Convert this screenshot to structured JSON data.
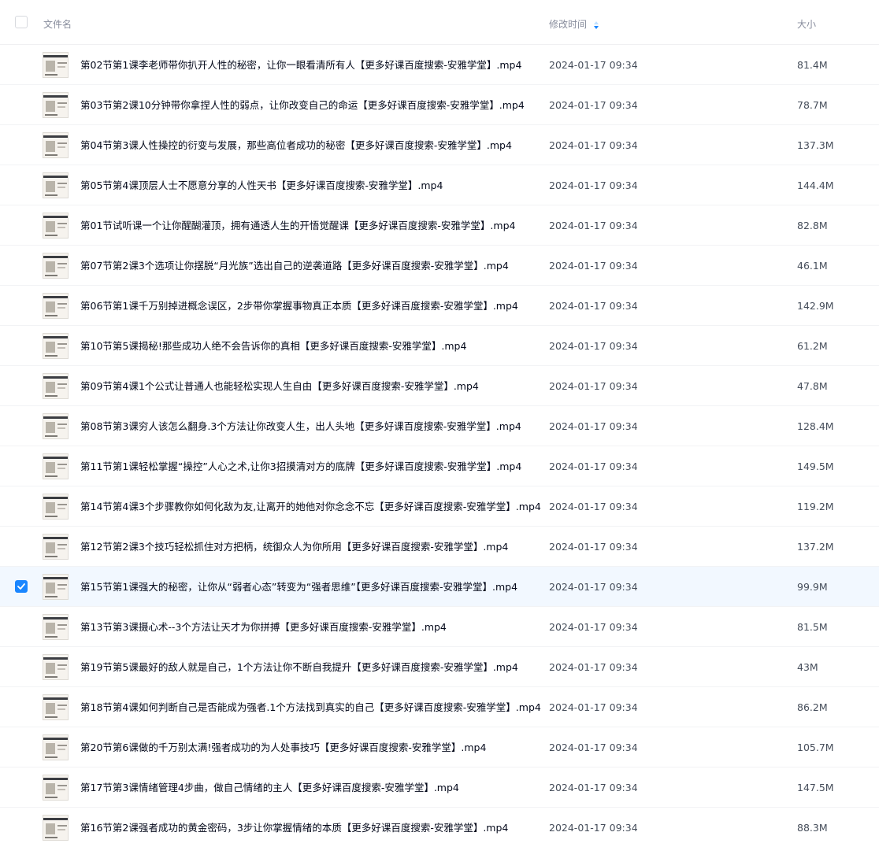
{
  "header": {
    "name_label": "文件名",
    "time_label": "修改时间",
    "size_label": "大小",
    "sort_icon": "sort-desc-icon"
  },
  "colors": {
    "accent": "#1a86ff",
    "selected_row": "#f2f8ff",
    "header_text": "#878c9c"
  },
  "thumbnail_icon": "video-thumbnail-icon",
  "files": [
    {
      "name": "第02节第1课李老师带你扒开人性的秘密，让你一眼看清所有人【更多好课百度搜索-安雅学堂】.mp4",
      "modified": "2024-01-17 09:34",
      "size": "81.4M",
      "selected": false
    },
    {
      "name": "第03节第2课10分钟带你拿捏人性的弱点，让你改变自己的命运【更多好课百度搜索-安雅学堂】.mp4",
      "modified": "2024-01-17 09:34",
      "size": "78.7M",
      "selected": false
    },
    {
      "name": "第04节第3课人性操控的衍变与发展，那些高位者成功的秘密【更多好课百度搜索-安雅学堂】.mp4",
      "modified": "2024-01-17 09:34",
      "size": "137.3M",
      "selected": false
    },
    {
      "name": "第05节第4课顶层人士不愿意分享的人性天书【更多好课百度搜索-安雅学堂】.mp4",
      "modified": "2024-01-17 09:34",
      "size": "144.4M",
      "selected": false
    },
    {
      "name": "第01节试听课一个让你醒醐灌顶，拥有通透人生的开悟觉醒课【更多好课百度搜索-安雅学堂】.mp4",
      "modified": "2024-01-17 09:34",
      "size": "82.8M",
      "selected": false
    },
    {
      "name": "第07节第2课3个选项让你摆脱“月光族”选出自己的逆袭道路【更多好课百度搜索-安雅学堂】.mp4",
      "modified": "2024-01-17 09:34",
      "size": "46.1M",
      "selected": false
    },
    {
      "name": "第06节第1课千万别掉进概念误区，2步带你掌握事物真正本质【更多好课百度搜索-安雅学堂】.mp4",
      "modified": "2024-01-17 09:34",
      "size": "142.9M",
      "selected": false
    },
    {
      "name": "第10节第5课揭秘!那些成功人绝不会告诉你的真相【更多好课百度搜索-安雅学堂】.mp4",
      "modified": "2024-01-17 09:34",
      "size": "61.2M",
      "selected": false
    },
    {
      "name": "第09节第4课1个公式让普通人也能轻松实现人生自由【更多好课百度搜索-安雅学堂】.mp4",
      "modified": "2024-01-17 09:34",
      "size": "47.8M",
      "selected": false
    },
    {
      "name": "第08节第3课穷人该怎么翻身.3个方法让你改变人生，出人头地【更多好课百度搜索-安雅学堂】.mp4",
      "modified": "2024-01-17 09:34",
      "size": "128.4M",
      "selected": false
    },
    {
      "name": "第11节第1课轻松掌握“操控”人心之术,让你3招摸清对方的底牌【更多好课百度搜索-安雅学堂】.mp4",
      "modified": "2024-01-17 09:34",
      "size": "149.5M",
      "selected": false
    },
    {
      "name": "第14节第4课3个步骤教你如何化敌为友,让离开的她他对你念念不忘【更多好课百度搜索-安雅学堂】.mp4",
      "modified": "2024-01-17 09:34",
      "size": "119.2M",
      "selected": false
    },
    {
      "name": "第12节第2课3个技巧轻松抓住对方把柄，统御众人为你所用【更多好课百度搜索-安雅学堂】.mp4",
      "modified": "2024-01-17 09:34",
      "size": "137.2M",
      "selected": false
    },
    {
      "name": "第15节第1课强大的秘密，让你从“弱者心态”转变为“强者思维”【更多好课百度搜索-安雅学堂】.mp4",
      "modified": "2024-01-17 09:34",
      "size": "99.9M",
      "selected": true
    },
    {
      "name": "第13节第3课摄心术--3个方法让天才为你拼搏【更多好课百度搜索-安雅学堂】.mp4",
      "modified": "2024-01-17 09:34",
      "size": "81.5M",
      "selected": false
    },
    {
      "name": "第19节第5课最好的敌人就是自己，1个方法让你不断自我提升【更多好课百度搜索-安雅学堂】.mp4",
      "modified": "2024-01-17 09:34",
      "size": "43M",
      "selected": false
    },
    {
      "name": "第18节第4课如何判断自己是否能成为强者.1个方法找到真实的自己【更多好课百度搜索-安雅学堂】.mp4",
      "modified": "2024-01-17 09:34",
      "size": "86.2M",
      "selected": false
    },
    {
      "name": "第20节第6课做的千万别太满!强者成功的为人处事技巧【更多好课百度搜索-安雅学堂】.mp4",
      "modified": "2024-01-17 09:34",
      "size": "105.7M",
      "selected": false
    },
    {
      "name": "第17节第3课情绪管理4步曲，做自己情绪的主人【更多好课百度搜索-安雅学堂】.mp4",
      "modified": "2024-01-17 09:34",
      "size": "147.5M",
      "selected": false
    },
    {
      "name": "第16节第2课强者成功的黄金密码，3步让你掌握情绪的本质【更多好课百度搜索-安雅学堂】.mp4",
      "modified": "2024-01-17 09:34",
      "size": "88.3M",
      "selected": false
    }
  ]
}
